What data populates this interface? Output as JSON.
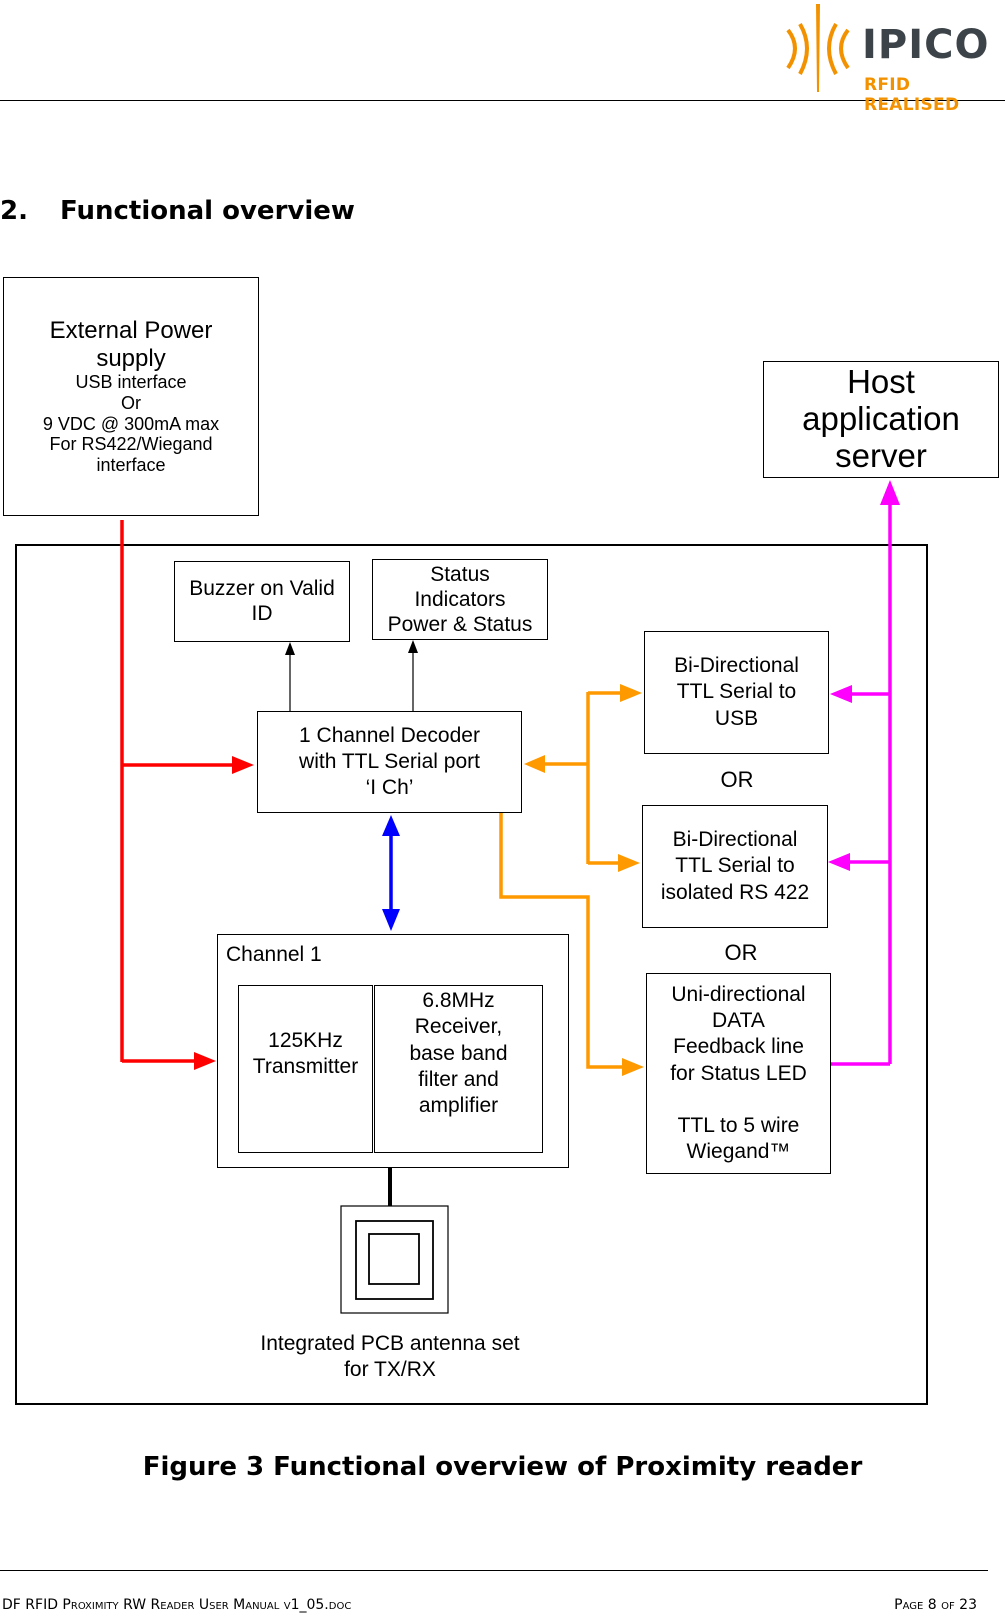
{
  "header": {
    "logo": {
      "brand": "IPICO",
      "tagline": "RFID REALISED",
      "colors": {
        "brand": "#3d4449",
        "accent": "#f39200"
      }
    }
  },
  "section": {
    "number": "2.",
    "title": "Functional overview"
  },
  "diagram": {
    "external_power": {
      "title_lines": [
        "External Power",
        "supply"
      ],
      "detail_lines": [
        "USB interface",
        "Or",
        "9 VDC @ 300mA max",
        "For RS422/Wiegand",
        "interface"
      ]
    },
    "host": {
      "lines": [
        "Host",
        "application",
        "server"
      ]
    },
    "buzzer": {
      "lines": [
        "Buzzer on Valid",
        "ID"
      ]
    },
    "status": {
      "lines": [
        "Status",
        "Indicators",
        "Power & Status"
      ]
    },
    "decoder": {
      "lines": [
        "1 Channel Decoder",
        "with TTL Serial port",
        "‘I Ch’"
      ]
    },
    "usb": {
      "lines": [
        "Bi-Directional",
        "TTL Serial to",
        "USB"
      ]
    },
    "or_1": "OR",
    "rs422": {
      "lines": [
        "Bi-Directional",
        "TTL Serial to",
        "isolated RS 422"
      ]
    },
    "or_2": "OR",
    "wiegand": {
      "lines": [
        "Uni-directional",
        "DATA",
        "Feedback line",
        "for Status LED",
        "",
        "TTL to 5 wire",
        "Wiegand™"
      ]
    },
    "channel": {
      "label": "Channel 1",
      "transmitter": {
        "lines": [
          "125KHz",
          "Transmitter"
        ]
      },
      "receiver": {
        "lines": [
          "6.8MHz",
          "Receiver,",
          "base band",
          "filter and",
          "amplifier"
        ]
      }
    },
    "antenna": {
      "lines": [
        "Integrated PCB antenna set",
        "for TX/RX"
      ]
    },
    "wire_colors": {
      "power": "#ff0000",
      "serial": "#ff9900",
      "rf": "#0000ff",
      "host": "#ff00ff"
    }
  },
  "caption": "Figure 3 Functional overview of Proximity reader",
  "footer": {
    "document": "DF RFID Proximity RW Reader User Manual v1_05.doc",
    "page": "Page 8 of 23"
  }
}
